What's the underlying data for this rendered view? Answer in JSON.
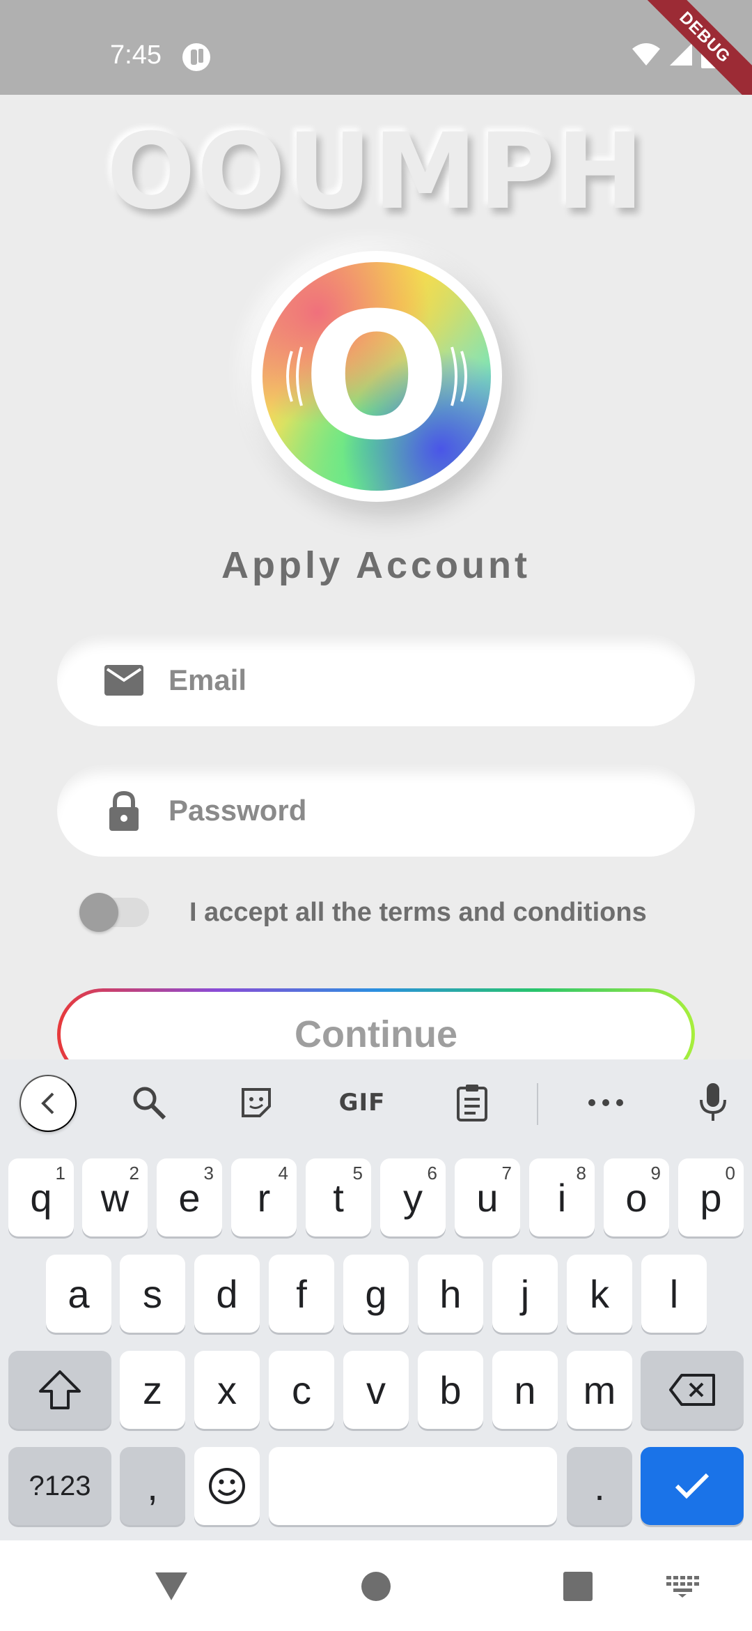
{
  "status_bar": {
    "time": "7:45",
    "debug_label": "DEBUG",
    "icons": [
      "app-notification-icon",
      "wifi-icon",
      "signal-icon",
      "battery-icon"
    ],
    "background": "#b0b0b0"
  },
  "brand": {
    "title": "OOUMPH",
    "logo_letter": "O"
  },
  "form": {
    "heading": "Apply Account",
    "email_placeholder": "Email",
    "email_value": "",
    "password_placeholder": "Password",
    "password_value": "",
    "terms_label": "I accept all the terms and conditions",
    "terms_accepted": false,
    "continue_label": "Continue"
  },
  "keyboard": {
    "toolbar": [
      "back-arrow-icon",
      "search-icon",
      "sticker-icon",
      "gif",
      "clipboard-icon",
      "more-icon",
      "mic-icon"
    ],
    "gif_label": "GIF",
    "row1": [
      {
        "key": "q",
        "hint": "1"
      },
      {
        "key": "w",
        "hint": "2"
      },
      {
        "key": "e",
        "hint": "3"
      },
      {
        "key": "r",
        "hint": "4"
      },
      {
        "key": "t",
        "hint": "5"
      },
      {
        "key": "y",
        "hint": "6"
      },
      {
        "key": "u",
        "hint": "7"
      },
      {
        "key": "i",
        "hint": "8"
      },
      {
        "key": "o",
        "hint": "9"
      },
      {
        "key": "p",
        "hint": "0"
      }
    ],
    "row2": [
      "a",
      "s",
      "d",
      "f",
      "g",
      "h",
      "j",
      "k",
      "l"
    ],
    "row3": [
      "z",
      "x",
      "c",
      "v",
      "b",
      "n",
      "m"
    ],
    "symbols_label": "?123",
    "comma_label": ",",
    "period_label": ".",
    "enter_color": "#1a73e8"
  },
  "nav_bar": {
    "items": [
      "back-triangle-icon",
      "home-circle-icon",
      "recents-square-icon",
      "keyboard-switch-icon"
    ]
  },
  "colors": {
    "background": "#ececec",
    "heading_text": "#6e6e6e",
    "debug_ribbon": "#9c2b35"
  }
}
